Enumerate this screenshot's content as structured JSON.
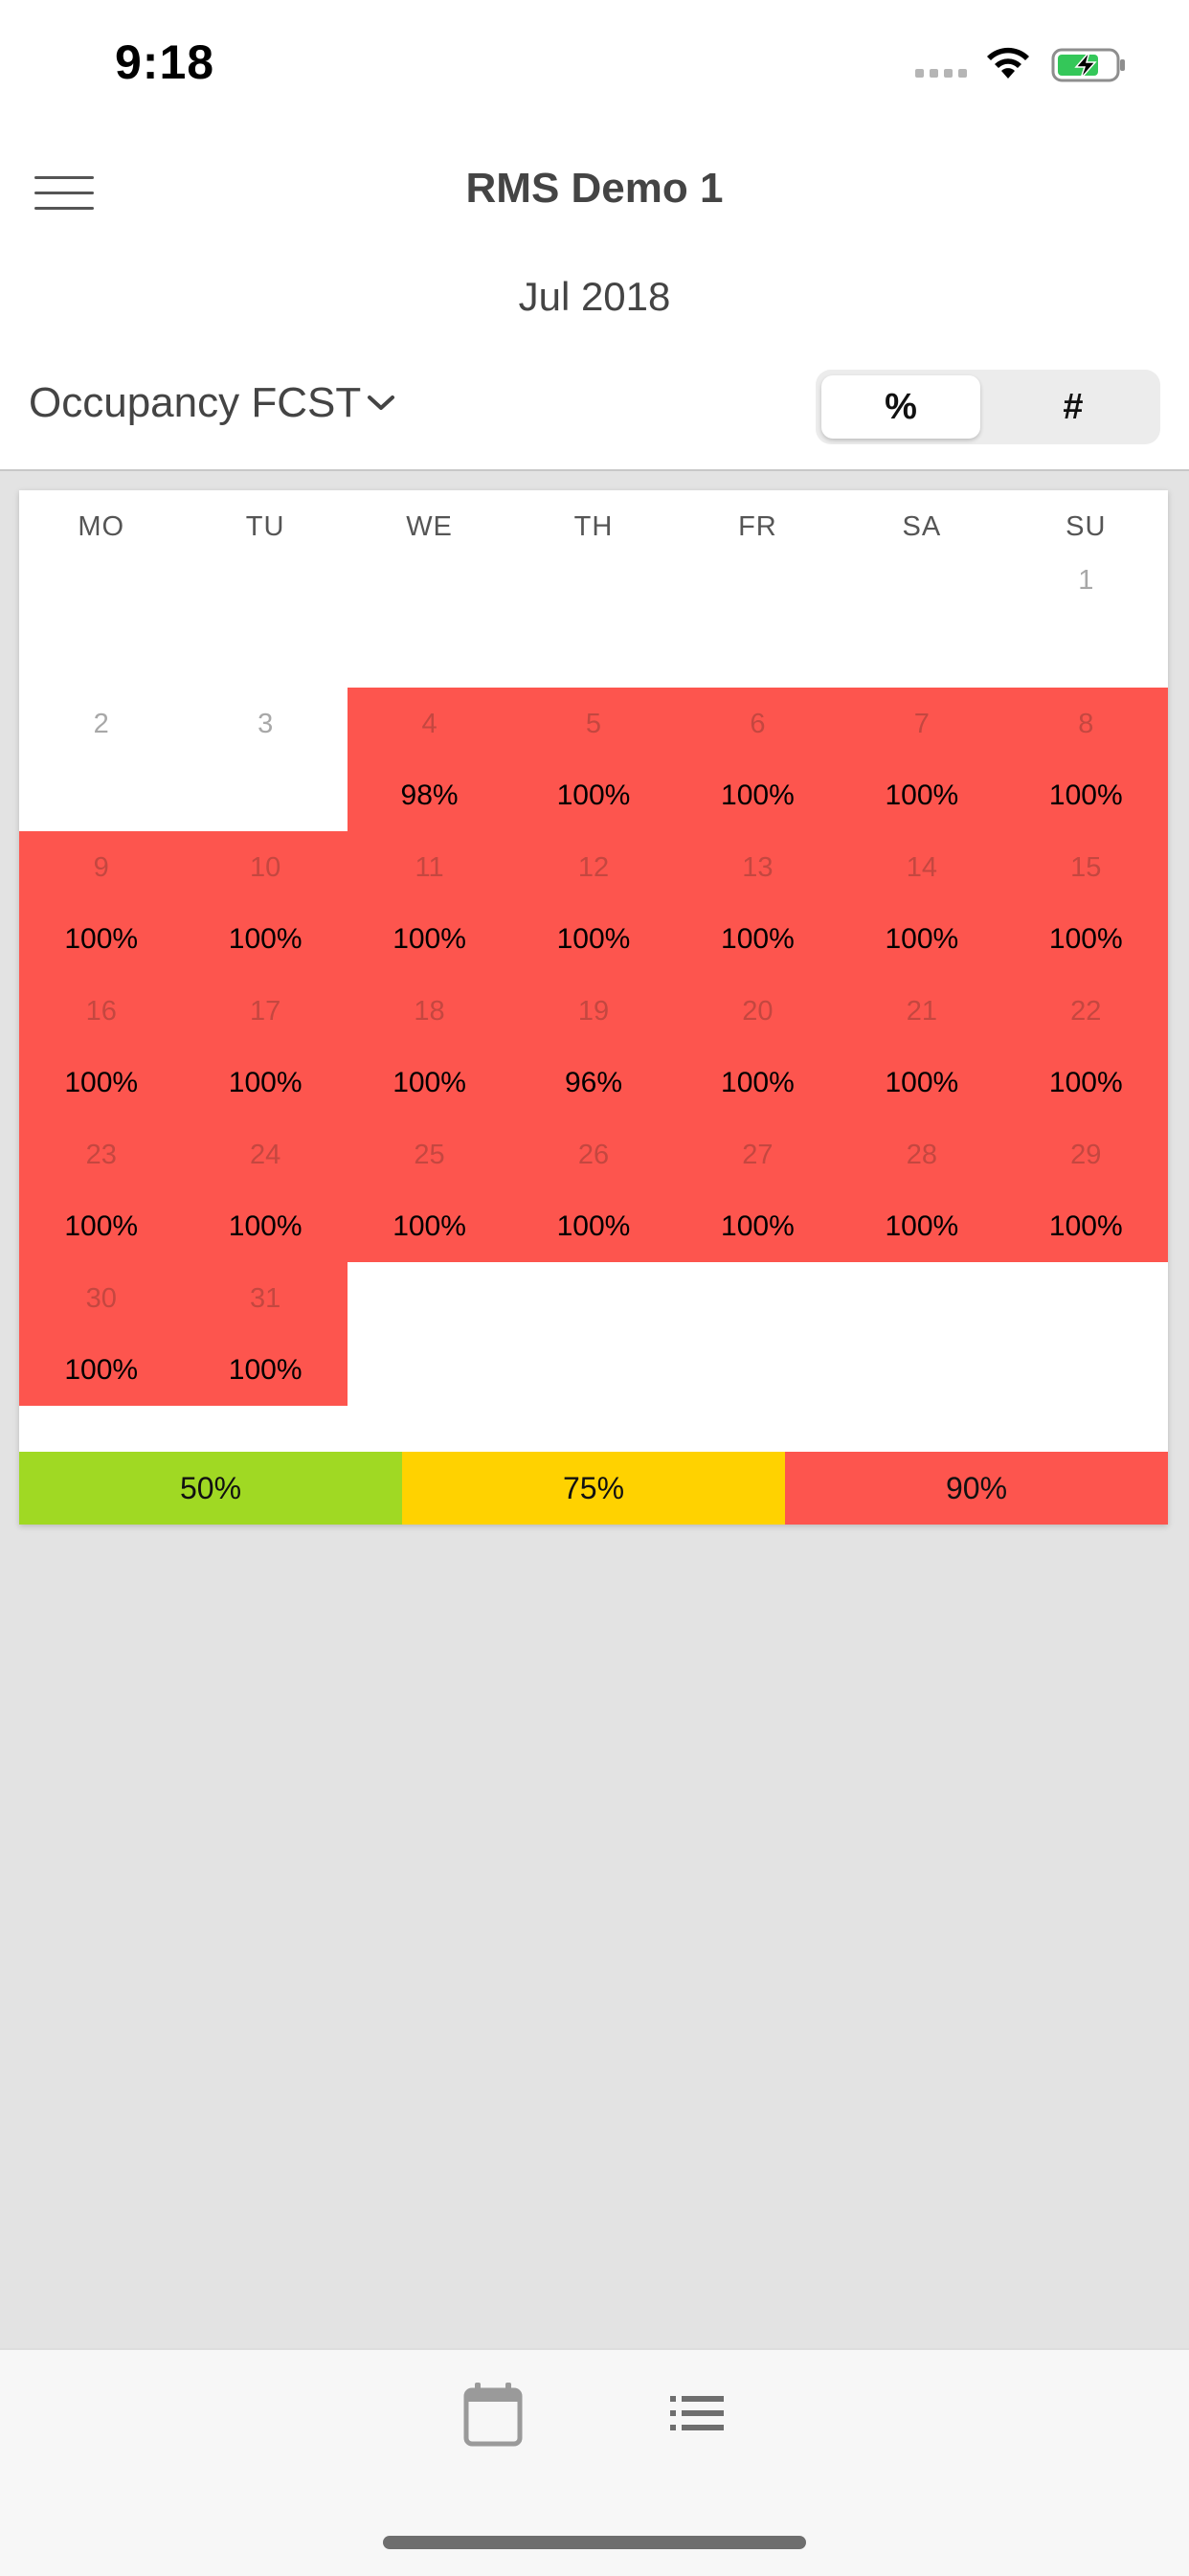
{
  "status_bar": {
    "time": "9:18",
    "icons": [
      "signal-icon",
      "wifi-icon",
      "battery-charging-icon"
    ]
  },
  "header": {
    "title": "RMS Demo 1",
    "month": "Jul 2018",
    "menu_icon": "hamburger-menu-icon",
    "metric_label": "Occupancy FCST",
    "metric_chevron": "chevron-down-icon",
    "toggle": {
      "options": [
        "%",
        "#"
      ],
      "selected": "%"
    }
  },
  "calendar": {
    "weekdays": [
      "MO",
      "TU",
      "WE",
      "TH",
      "FR",
      "SA",
      "SU"
    ],
    "days": [
      {
        "day": "1",
        "value": ""
      },
      {
        "day": "2",
        "value": ""
      },
      {
        "day": "3",
        "value": ""
      },
      {
        "day": "4",
        "value": "98%"
      },
      {
        "day": "5",
        "value": "100%"
      },
      {
        "day": "6",
        "value": "100%"
      },
      {
        "day": "7",
        "value": "100%"
      },
      {
        "day": "8",
        "value": "100%"
      },
      {
        "day": "9",
        "value": "100%"
      },
      {
        "day": "10",
        "value": "100%"
      },
      {
        "day": "11",
        "value": "100%"
      },
      {
        "day": "12",
        "value": "100%"
      },
      {
        "day": "13",
        "value": "100%"
      },
      {
        "day": "14",
        "value": "100%"
      },
      {
        "day": "15",
        "value": "100%"
      },
      {
        "day": "16",
        "value": "100%"
      },
      {
        "day": "17",
        "value": "100%"
      },
      {
        "day": "18",
        "value": "100%"
      },
      {
        "day": "19",
        "value": "96%"
      },
      {
        "day": "20",
        "value": "100%"
      },
      {
        "day": "21",
        "value": "100%"
      },
      {
        "day": "22",
        "value": "100%"
      },
      {
        "day": "23",
        "value": "100%"
      },
      {
        "day": "24",
        "value": "100%"
      },
      {
        "day": "25",
        "value": "100%"
      },
      {
        "day": "26",
        "value": "100%"
      },
      {
        "day": "27",
        "value": "100%"
      },
      {
        "day": "28",
        "value": "100%"
      },
      {
        "day": "29",
        "value": "100%"
      },
      {
        "day": "30",
        "value": "100%"
      },
      {
        "day": "31",
        "value": "100%"
      }
    ],
    "legend": [
      {
        "label": "50%",
        "color": "#a0d923"
      },
      {
        "label": "75%",
        "color": "#ffd200"
      },
      {
        "label": "90%",
        "color": "#fd554e"
      }
    ]
  },
  "tabbar": {
    "tabs": [
      {
        "icon": "calendar-icon"
      },
      {
        "icon": "list-icon"
      }
    ]
  }
}
